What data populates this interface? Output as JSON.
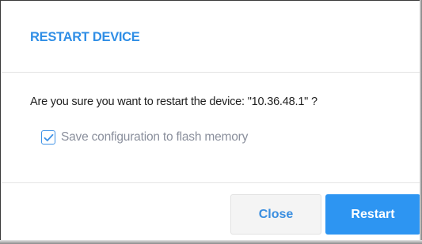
{
  "dialog": {
    "title": "RESTART DEVICE",
    "message": "Are you sure you want to restart the device: \"10.36.48.1\" ?",
    "checkbox": {
      "label": "Save configuration to flash memory",
      "checked": true
    },
    "buttons": {
      "close_label": "Close",
      "restart_label": "Restart"
    }
  },
  "colors": {
    "accent": "#2f8ee6",
    "primary_button": "#2d95f2",
    "secondary_button_bg": "#f4f4f4",
    "muted_text": "#8a8f9c"
  },
  "icons": {
    "checkbox_mark": "check-icon"
  }
}
